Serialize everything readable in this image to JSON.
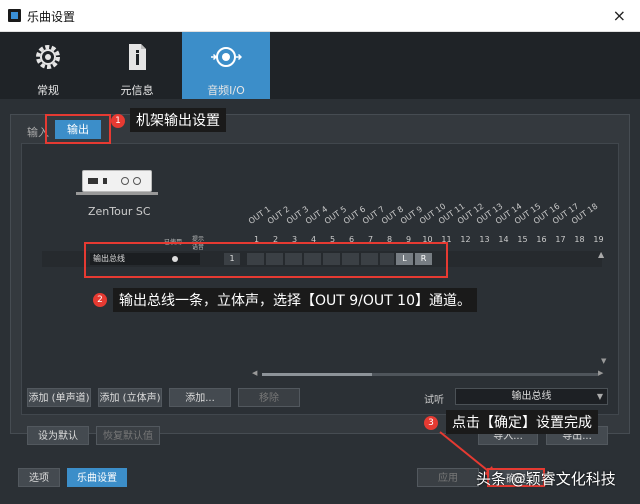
{
  "window": {
    "title": "乐曲设置",
    "close_glyph": "×"
  },
  "top_tabs": [
    {
      "label": "常规",
      "icon": "gear-icon",
      "active": false
    },
    {
      "label": "元信息",
      "icon": "document-info-icon",
      "active": false
    },
    {
      "label": "音频I/O",
      "icon": "audio-io-icon",
      "active": true
    }
  ],
  "sub_tabs": {
    "input": "输入",
    "output": "输出"
  },
  "device": {
    "name": "ZenTour SC"
  },
  "matrix": {
    "columns": [
      "OUT 1",
      "OUT 2",
      "OUT 3",
      "OUT 4",
      "OUT 5",
      "OUT 6",
      "OUT 7",
      "OUT 8",
      "OUT 9",
      "OUT 10",
      "OUT 11",
      "OUT 12",
      "OUT 13",
      "OUT 14",
      "OUT 15",
      "OUT 16",
      "OUT 17",
      "OUT 18"
    ],
    "column_numbers": [
      "1",
      "2",
      "3",
      "4",
      "5",
      "6",
      "7",
      "8",
      "9",
      "10",
      "11",
      "12",
      "13",
      "14",
      "15",
      "16",
      "17",
      "18",
      "19"
    ],
    "small_headers": [
      "已使用",
      "提示",
      "语音"
    ],
    "row": {
      "name": "输出总线",
      "channel": "1",
      "left": "L",
      "right": "R"
    }
  },
  "buttons": {
    "add_mono": "添加 (单声道)",
    "add_stereo": "添加 (立体声)",
    "add_more": "添加...",
    "remove": "移除",
    "set_default": "设为默认",
    "restore_default": "恢复默认值",
    "import": "导入...",
    "export": "导出...",
    "options": "选项",
    "song_setup": "乐曲设置",
    "apply": "应用",
    "ok": "确定"
  },
  "audition": {
    "label": "试听",
    "value": "输出总线"
  },
  "annotations": [
    {
      "num": "1",
      "text": "机架输出设置"
    },
    {
      "num": "2",
      "text": "输出总线一条，立体声，选择【OUT 9/OUT 10】通道。"
    },
    {
      "num": "3",
      "text": "点击【确定】设置完成"
    }
  ],
  "watermark": "头条 @颖睿文化科技",
  "colors": {
    "accent": "#3c8ec9",
    "annotation_red": "#e63a32",
    "background": "#2b3035"
  }
}
